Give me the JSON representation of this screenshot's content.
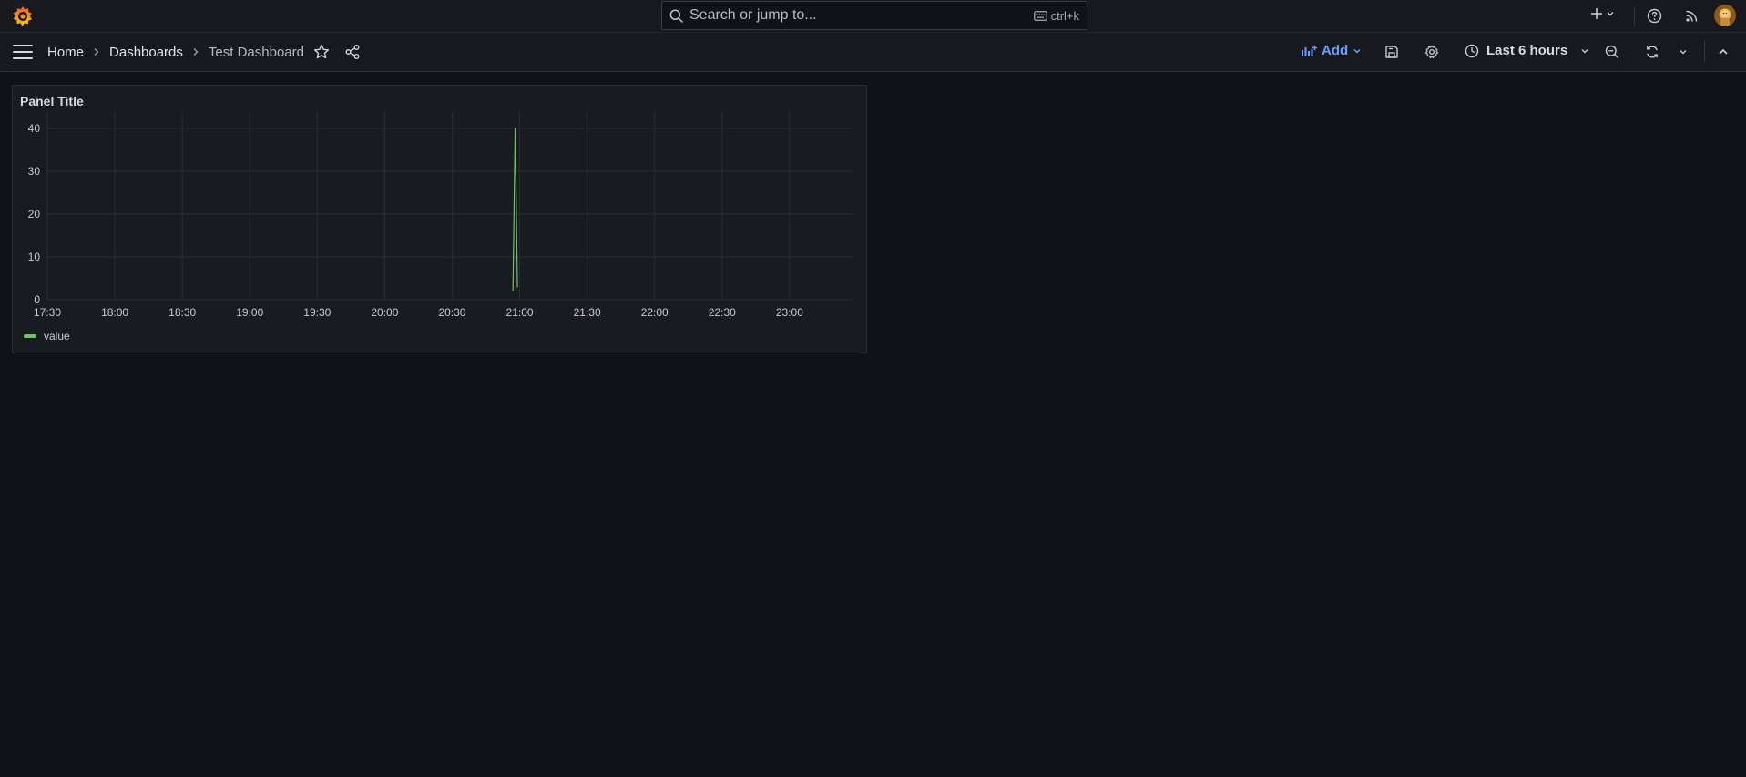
{
  "topbar": {
    "search_placeholder": "Search or jump to...",
    "search_shortcut": "ctrl+k",
    "icons": [
      "grafana-logo-icon",
      "search-icon",
      "keyboard-icon",
      "plus-icon",
      "help-icon",
      "rss-icon",
      "avatar"
    ]
  },
  "breadcrumb": {
    "home": "Home",
    "dashboards": "Dashboards",
    "current": "Test Dashboard"
  },
  "toolbar": {
    "add_label": "Add",
    "time_range": "Last 6 hours"
  },
  "panel": {
    "title": "Panel Title"
  },
  "colors": {
    "accent": "#6e9fff",
    "series": "#73bf69",
    "background": "#111217",
    "panel": "#181b1f"
  },
  "chart_data": {
    "type": "line",
    "title": "Panel Title",
    "x_ticks": [
      "17:30",
      "18:00",
      "18:30",
      "19:00",
      "19:30",
      "20:00",
      "20:30",
      "21:00",
      "21:30",
      "22:00",
      "22:30",
      "23:00"
    ],
    "y_ticks": [
      0,
      10,
      20,
      30,
      40
    ],
    "ylim": [
      0,
      44
    ],
    "xlim": [
      "17:30",
      "23:28"
    ],
    "grid": true,
    "legend": "bottom-left",
    "series": [
      {
        "name": "value",
        "color": "#73bf69",
        "points": [
          {
            "x": "20:57",
            "y": 2
          },
          {
            "x": "20:58",
            "y": 40
          },
          {
            "x": "20:59",
            "y": 3
          }
        ]
      }
    ]
  }
}
